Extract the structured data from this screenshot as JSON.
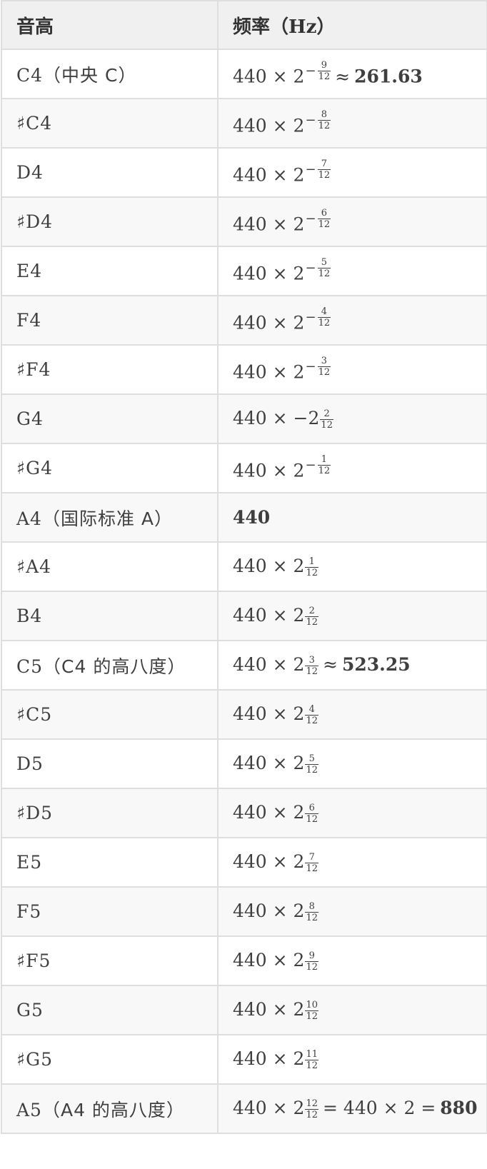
{
  "header": {
    "pitch": "音高",
    "freq": "频率",
    "freq_unit": "（Hz）"
  },
  "rows": [
    {
      "note": "C4",
      "note_extra": "（中央 C）",
      "base": "440 × 2",
      "sign": "−",
      "num": "9",
      "den": "12",
      "rel": "≈",
      "result": "261.63"
    },
    {
      "note": "♯C4",
      "base": "440 × 2",
      "sign": "−",
      "num": "8",
      "den": "12"
    },
    {
      "note": "D4",
      "base": "440 × 2",
      "sign": "−",
      "num": "7",
      "den": "12"
    },
    {
      "note": "♯D4",
      "base": "440 × 2",
      "sign": "−",
      "num": "6",
      "den": "12"
    },
    {
      "note": "E4",
      "base": "440 × 2",
      "sign": "−",
      "num": "5",
      "den": "12"
    },
    {
      "note": "F4",
      "base": "440 × 2",
      "sign": "−",
      "num": "4",
      "den": "12"
    },
    {
      "note": "♯F4",
      "base": "440 × 2",
      "sign": "−",
      "num": "3",
      "den": "12"
    },
    {
      "note": "G4",
      "base": "440 × −2",
      "sign": "",
      "num": "2",
      "den": "12"
    },
    {
      "note": "♯G4",
      "base": "440 × 2",
      "sign": "−",
      "num": "1",
      "den": "12"
    },
    {
      "note": "A4",
      "note_extra": "（国际标准 A）",
      "plain_bold": "440"
    },
    {
      "note": "♯A4",
      "base": "440 × 2",
      "sign": "",
      "num": "1",
      "den": "12"
    },
    {
      "note": "B4",
      "base": "440 × 2",
      "sign": "",
      "num": "2",
      "den": "12"
    },
    {
      "note": "C5",
      "note_extra": "（C4 的高八度）",
      "base": "440 × 2",
      "sign": "",
      "num": "3",
      "den": "12",
      "rel": "≈",
      "result": "523.25"
    },
    {
      "note": "♯C5",
      "base": "440 × 2",
      "sign": "",
      "num": "4",
      "den": "12"
    },
    {
      "note": "D5",
      "base": "440 × 2",
      "sign": "",
      "num": "5",
      "den": "12"
    },
    {
      "note": "♯D5",
      "base": "440 × 2",
      "sign": "",
      "num": "6",
      "den": "12"
    },
    {
      "note": "E5",
      "base": "440 × 2",
      "sign": "",
      "num": "7",
      "den": "12"
    },
    {
      "note": "F5",
      "base": "440 × 2",
      "sign": "",
      "num": "8",
      "den": "12"
    },
    {
      "note": "♯F5",
      "base": "440 × 2",
      "sign": "",
      "num": "9",
      "den": "12"
    },
    {
      "note": "G5",
      "base": "440 × 2",
      "sign": "",
      "num": "10",
      "den": "12"
    },
    {
      "note": "♯G5",
      "base": "440 × 2",
      "sign": "",
      "num": "11",
      "den": "12"
    },
    {
      "note": "A5",
      "note_extra": "（A4 的高八度）",
      "base": "440 × 2",
      "sign": "",
      "num": "12",
      "den": "12",
      "tail": "= 440 × 2 =",
      "result": "880"
    }
  ]
}
